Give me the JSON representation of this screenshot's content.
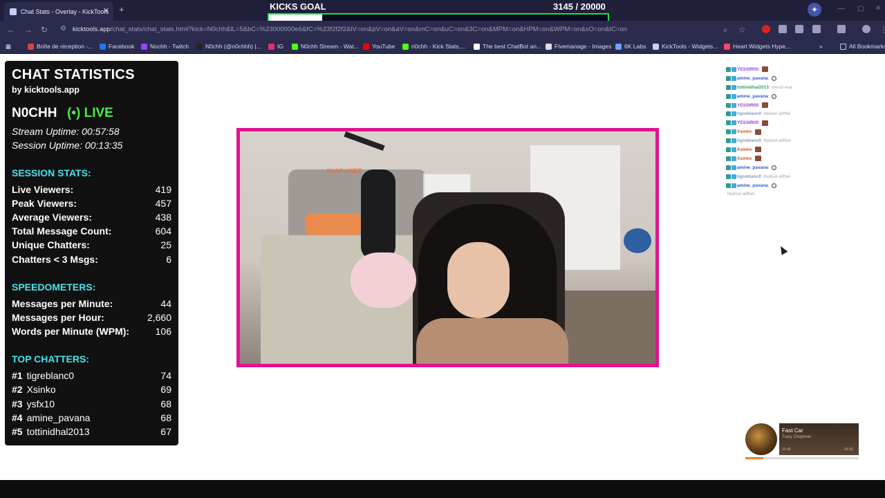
{
  "browser": {
    "tab_title": "Chat Stats - Overlay - KickTools",
    "url_host": "kicktools.app",
    "url_path": "/chat_stats/chat_stats.html?kick=N0chh&lL=5&bC=%23000000e6&fC=%23f2f2f2&lV=on&pV=on&aV=on&mC=on&uC=on&3C=on&MPM=on&HPM=on&WPM=on&sO=on&tC=on",
    "bookmarks": [
      {
        "label": "Boîte de réception -...",
        "color": "#d44638"
      },
      {
        "label": "Facebook",
        "color": "#1877f2"
      },
      {
        "label": "Nochh - Twitch",
        "color": "#9146ff"
      },
      {
        "label": "N0chh (@n0chhh) |...",
        "color": "#222222"
      },
      {
        "label": "IG",
        "color": "#e1306c"
      },
      {
        "label": "N0chh Stream - Wat...",
        "color": "#53fc18"
      },
      {
        "label": "YouTube",
        "color": "#ff0000"
      },
      {
        "label": "n0chh - Kick Stats,...",
        "color": "#53fc18"
      },
      {
        "label": "The best ChatBot an...",
        "color": "#ffffff"
      },
      {
        "label": "Fivemanage - Images",
        "color": "#dddddd"
      },
      {
        "label": "6K Labs",
        "color": "#6aa0ff"
      },
      {
        "label": "KickTools - Widgets...",
        "color": "#c8d0ff"
      },
      {
        "label": "Heart Widgets Hype...",
        "color": "#ff4466"
      }
    ],
    "all_bookmarks": "All Bookmarks"
  },
  "goal": {
    "title": "KICKS GOAL",
    "count": "3145  / 20000",
    "progress": 0.157
  },
  "stats": {
    "title": "CHAT STATISTICS",
    "byline": "by kicktools.app",
    "username": "N0CHH",
    "live_label": "(•) LIVE",
    "stream_uptime": "Stream Uptime: 00:57:58",
    "session_uptime": "Session Uptime: 00:13:35",
    "session_header": "SESSION STATS:",
    "session": [
      {
        "label": "Live Viewers:",
        "value": "419"
      },
      {
        "label": "Peak Viewers:",
        "value": "457"
      },
      {
        "label": "Average Viewers:",
        "value": "438"
      },
      {
        "label": "Total Message Count:",
        "value": "604"
      },
      {
        "label": "Unique Chatters:",
        "value": "25"
      },
      {
        "label": "Chatters < 3 Msgs:",
        "value": "6"
      }
    ],
    "speed_header": "SPEEDOMETERS:",
    "speed": [
      {
        "label": "Messages per Minute:",
        "value": "44"
      },
      {
        "label": "Messages per Hour:",
        "value": "2,660"
      },
      {
        "label": "Words per Minute (WPM):",
        "value": "106"
      }
    ],
    "top_header": "TOP CHATTERS:",
    "top": [
      {
        "rank": "#1",
        "name": "tigreblanc0",
        "value": "74"
      },
      {
        "rank": "#2",
        "name": "Xsinko",
        "value": "69"
      },
      {
        "rank": "#3",
        "name": "ysfx10",
        "value": "68"
      },
      {
        "rank": "#4",
        "name": "amine_pavana",
        "value": "68"
      },
      {
        "rank": "#5",
        "name": "tottinidhal2013",
        "value": "67"
      }
    ]
  },
  "cam": {
    "tag": "SNAP USER"
  },
  "chat": [
    {
      "user": "YESSIR05",
      "color": "#9b3dd8",
      "emote": "pic",
      "text": ""
    },
    {
      "user": "amine_pavana",
      "color": "#3355cc",
      "emote": "skull",
      "text": ""
    },
    {
      "user": "tottinidhal2013",
      "color": "#33a060",
      "emote": "",
      "text": "mesdi ena"
    },
    {
      "user": "amine_pavana",
      "color": "#3355cc",
      "emote": "skull",
      "text": ""
    },
    {
      "user": "YESSIR05",
      "color": "#9b3dd8",
      "emote": "pic",
      "text": ""
    },
    {
      "user": "tigreblanc0",
      "color": "#8899bb",
      "emote": "",
      "text": "lbellsel alifbel"
    },
    {
      "user": "YESSIR05",
      "color": "#9b3dd8",
      "emote": "pic",
      "text": ""
    },
    {
      "user": "Xsinko",
      "color": "#cc5522",
      "emote": "pic",
      "text": ""
    },
    {
      "user": "tigreblanc0",
      "color": "#8899bb",
      "emote": "",
      "text": "lbellsel alifbel"
    },
    {
      "user": "Xsinko",
      "color": "#cc5522",
      "emote": "pic",
      "text": ""
    },
    {
      "user": "Xsinko",
      "color": "#cc5522",
      "emote": "pic",
      "text": ""
    },
    {
      "user": "amine_pavana",
      "color": "#3355cc",
      "emote": "skull",
      "text": ""
    },
    {
      "user": "tigreblanc0",
      "color": "#8899bb",
      "emote": "",
      "text": "lbellsel alifbel"
    },
    {
      "user": "amine_pavana",
      "color": "#3355cc",
      "emote": "skull",
      "text": ""
    },
    {
      "user": "",
      "color": "#8899bb",
      "emote": "",
      "text": "lbellsel alifbel"
    }
  ],
  "music": {
    "title": "Fast Car",
    "artist": "Tracy Chapman",
    "elapsed": "00:48",
    "total": "04:58",
    "progress": 0.16
  }
}
